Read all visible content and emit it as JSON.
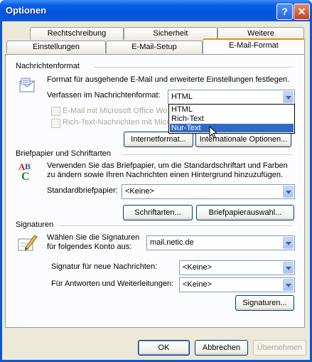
{
  "window": {
    "title": "Optionen"
  },
  "tabs_row1": [
    "Rechtschreibung",
    "Sicherheit",
    "Weitere"
  ],
  "tabs_row2": [
    "Einstellungen",
    "E-Mail-Setup",
    "E-Mail-Format"
  ],
  "active_tab": "E-Mail-Format",
  "message_format": {
    "heading": "Nachrichtenformat",
    "description": "Format für ausgehende E-Mail und erweiterte Einstellungen festlegen.",
    "compose_label": "Verfassen im Nachrichtenformat:",
    "compose_value": "HTML",
    "compose_options": [
      "HTML",
      "Rich-Text",
      "Nur-Text"
    ],
    "highlighted_option": "Nur-Text",
    "checkbox_word": "E-Mail mit Microsoft Office Word",
    "checkbox_rtf": "Rich-Text-Nachrichten mit Micro",
    "internet_format_button": "Internetformat...",
    "intl_options_button": "Internationale Optionen..."
  },
  "stationery": {
    "heading": "Briefpapier und Schriftarten",
    "description_line1": "Verwenden Sie das Briefpapier, um die Standardschriftart und Farben",
    "description_line2": "zu ändern sowie Ihren Nachrichten einen Hintergrund hinzuzufügen.",
    "default_label": "Standardbriefpapier:",
    "default_value": "<Keine>",
    "fonts_button": "Schriftarten...",
    "stationery_button": "Briefpapierauswahl..."
  },
  "signatures": {
    "heading": "Signaturen",
    "choose_line1": "Wählen Sie die Signaturen",
    "choose_line2": "für folgendes Konto aus:",
    "account_value": "mail.netic.de",
    "new_label": "Signatur für neue Nachrichten:",
    "new_value": "<Keine>",
    "reply_label": "Für Antworten und Weiterleitungen:",
    "reply_value": "<Keine>",
    "signatures_button": "Signaturen..."
  },
  "footer": {
    "ok": "OK",
    "cancel": "Abbrechen",
    "apply": "Übernehmen"
  }
}
